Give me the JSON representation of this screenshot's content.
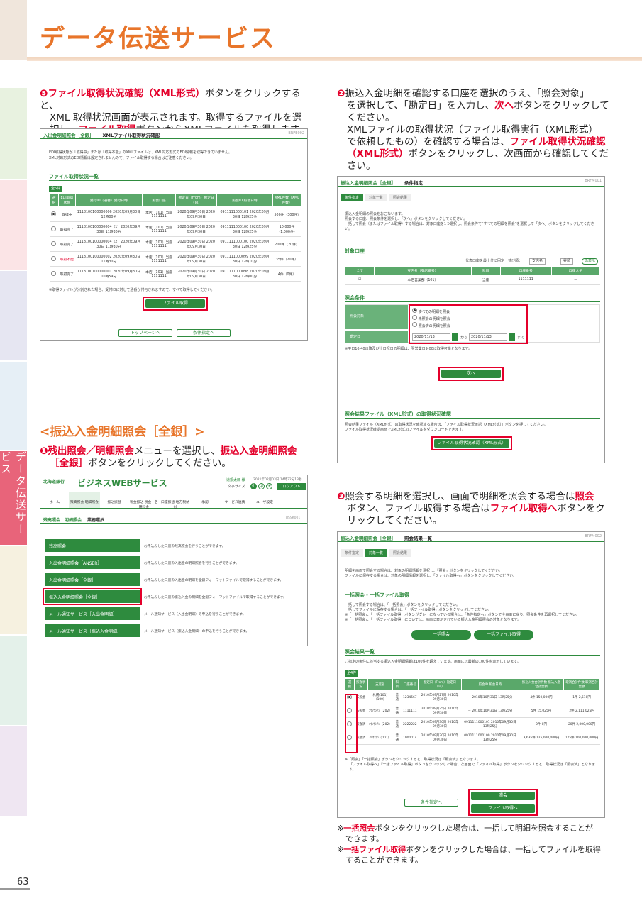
{
  "header": {
    "title": "データ伝送サービス"
  },
  "side_tab": "データ伝送サービス",
  "page_number": "63",
  "step5": {
    "num": "❺",
    "red1": "ファイル取得状況確認（XML形式）",
    "t1": "ボタンをクリックすると、",
    "l2": "XML 取得状況画面が表示されます。取得するファイルを選",
    "l3a": "択し、",
    "red2": "ファイル取得",
    "l3b": "ボタンからXMLファイルを取得します。"
  },
  "shot1": {
    "title": "入出金明細照会［全銀］",
    "subtitle": "XMLファイル取得状況確認",
    "id": "BRPE002",
    "note": "EDI取得状態が「取得中」または「取得不能」のXMLファイルは、XML対応形式のEDI情報を取得できていません。",
    "note2": "XML対応形式のEDI情報は設定されませんので、ファイル取得する場合はご注意ください。",
    "section": "ファイル取得状況一覧",
    "count": "全5件",
    "cols": [
      "選択",
      "EDI取得状態",
      "受付ID（通番）受付日時",
      "照会口座",
      "勘定日（From）勘定日（To）",
      "照会ID 照会日時",
      "XML件数（XML件数）"
    ],
    "rows": [
      [
        "取得中",
        "1118100100000006 2020年09月30日 12時00分",
        "本店（101）当座 1111111",
        "2020年09月30日 2020年09月30日",
        "0911111000101 2020年09月30日 12時25分",
        "500件（300件）"
      ],
      [
        "取得完了",
        "1118100100000004（1）2020年09月30日 11時30分",
        "本店（101）当座 1111111",
        "2020年09月30日 2020年09月30日",
        "0911111000100 2020年09月30日 12時25分",
        "10,000件（1,000件）"
      ],
      [
        "取得完了",
        "1118100100000004（2）2020年09月30日 11時30分",
        "本店（101）当座 1111111",
        "2020年09月30日 2020年09月30日",
        "0911111000100 2020年09月30日 12時25分",
        "200件（20件）"
      ],
      [
        "取得不能",
        "1118100100000002 2020年09月30日 11時30分",
        "本店（101）当座 1111111",
        "2020年09月30日 2020年09月30日",
        "0911111000099 2020年09月30日 12時10分",
        "35件（20件）"
      ],
      [
        "取得完了",
        "1118100100000001 2020年09月30日 10時59分",
        "本店（101）当座 1111111",
        "2020年09月30日 2020年09月30日",
        "0911111000098 2020年09月30日 12時00分",
        "4件（0件）"
      ]
    ],
    "footnote": "※取得ファイルが分割された場合、受付IDに対して通番が付与されますので、すべて取得してください。",
    "btn_get": "ファイル取得",
    "btn_top": "トップページへ",
    "btn_cond": "条件指定へ"
  },
  "section_title": "<振込入金明細照会［全銀］>",
  "step1": {
    "num": "❶",
    "red1": "残出照会／明細照会",
    "t1": "メニューを選択し、",
    "red2": "振込入金明細照会",
    "red3": "［全銀］",
    "t2": "ボタンをクリックしてください。"
  },
  "shot2": {
    "bank": "北海道銀行",
    "service": "ビジネスWEBサービス",
    "user": "道銀太郎 様",
    "date": "2021年02月03日 14時32分13秒",
    "fontsize": "文字サイズ",
    "small": "小",
    "mid": "中",
    "large": "大",
    "logout": "ログアウト",
    "nav": [
      "ホーム",
      "残高照会 明細照会",
      "振込振替",
      "税金振込 税金・各種料金",
      "口座振替 地方税納付",
      "承認",
      "サービス連携",
      "ユーザ設定"
    ],
    "breadcrumb": "残高照会　明細照会",
    "page": "業務選択",
    "id": "BSSK001",
    "menu": [
      {
        "label": "残高照会",
        "desc": "お申込みした口座の残高照会を行うことができます。"
      },
      {
        "label": "入出金明細照会［ANSER］",
        "desc": "お申込みした口座の入出金の明細照会を行うことができます。"
      },
      {
        "label": "入出金明細照会［全銀］",
        "desc": "お申込みした口座の入出金の明細を全銀フォーマットファイルで取得することができます。"
      },
      {
        "label": "振込入金明細照会［全銀］",
        "desc": "お申込みした口座の振込入金の明細を全銀フォーマットファイルで取得することができます。"
      },
      {
        "label": "メール通知サービス［入出金明細］",
        "desc": "メール通知サービス（入出金明細）の申込を行うことができます。"
      },
      {
        "label": "メール通知サービス［振込入金明細］",
        "desc": "メール通知サービス（振込入金明細）の申込を行うことができます。"
      }
    ]
  },
  "step2": {
    "num": "❷",
    "l1": "振込入金明細を確認する口座を選択のうえ、「照会対象」",
    "l2": "を選択して、「勘定日」を入力し、",
    "red1": "次へ",
    "l2b": "ボタンをクリックして",
    "l3": "ください。",
    "l4": "XMLファイルの取得状況（ファイル取得実行（XML形式）",
    "l5a": "で依頼したもの）を確認する場合は、",
    "red2": "ファイル取得状況確認",
    "red3": "（XML形式）",
    "l6b": "ボタンをクリックし、次画面から確認してくだ",
    "l7": "さい。"
  },
  "shot3": {
    "title": "振込入金明細照会［全銀］",
    "subtitle": "条件指定",
    "id": "BRFM001",
    "steps": [
      "条件指定",
      "対象一覧",
      "照会結果"
    ],
    "intro1": "振込入金明細の照会をおこないます。",
    "intro2": "照会する口座、照会条件を選択し、「次へ」ボタンをクリックしてください。",
    "intro3": "一括して照会（またはファイル取得）する場合は、対象口座を1つ選択し、照会条件で\"すべての明細を照会\"を選択して「次へ」ボタンをクリックしてください。",
    "acct_head": "対象口座",
    "acct_opts": "代表口座を最上位に固定　並び順：",
    "sel1": "支店名",
    "sel2": "昇順",
    "resort": "再表示",
    "cols": [
      "全て",
      "支店名（支店番号）",
      "科目",
      "口座番号",
      "口座メモ"
    ],
    "row": [
      "本店営業部（101）",
      "当座",
      "1111111",
      "－"
    ],
    "cond_head": "照会条件",
    "target_label": "照会対象",
    "opts": [
      "すべての明細を照会",
      "未照会の明細を照会",
      "照会済の明細を照会"
    ],
    "date_label": "勘定日",
    "date_from": "2020/11/13",
    "date_to": "2020/11/13",
    "kara": "から",
    "made": "まで",
    "note": "※平日16:40以降及び土日祝日の明細は、翌営業日9:00に取得可能となります。",
    "next": "次へ",
    "xml_head": "照会結果ファイル（XML形式）の取得状況確認",
    "xml_t1": "照会結果ファイル（XML形式）の取得状況を確認する場合は、「ファイル取得状況確認（XML形式）」ボタンを押してください。",
    "xml_t2": "ファイル取得状況確認画面でXML形式のファイルをダウンロードできます。",
    "xml_btn": "ファイル取得状況確認（XML形式）"
  },
  "step3": {
    "num": "❸",
    "l1a": "照会する明細を選択し、画面で明細を照会する場合は",
    "red1": "照会",
    "l2a": "ボタン、ファイル取得する場合は",
    "red2": "ファイル取得へ",
    "l2b": "ボタンをク",
    "l3": "リックしてください。"
  },
  "shot4": {
    "title": "振込入金明細照会［全銀］",
    "subtitle": "照会結果一覧",
    "id": "BRFM002",
    "steps": [
      "条件指定",
      "対象一覧",
      "照会結果"
    ],
    "intro1": "明細を画面で照会する場合は、対象の明細情報を選択し、「照会」ボタンをクリックしてください。",
    "intro2": "ファイルに保存する場合は、対象の明細情報を選択し、「ファイル取得へ」ボタンをクリックしてください。",
    "bulk_head": "一括照会・一括ファイル取得",
    "bulk_t1": "一括して照会する場合は、「一括照会」ボタンをクリックしてください。",
    "bulk_t2": "一括してファイルに保存する場合は、「一括ファイル取得」ボタンをクリックしてください。",
    "bulk_t3": "※「一括照会」、「一括ファイル取得」ボタンがグレーになっている場合は、「条件指定へ」ボタンで全画面に戻り、照会条件を再選択してください。",
    "bulk_t4": "※「一括照会」、「一括ファイル取得」については、画面に表示されている振込入金明細照会の対象となります。",
    "btn_bulk": "一括照会",
    "btn_bulkfile": "一括ファイル取得",
    "res_head": "照会結果一覧",
    "res_note": "ご指定の条件に該当する振込入金明細情報は100件を超えています。画面には最新の100件を表示しています。",
    "count": "全4件",
    "cols": [
      "選択",
      "照会状況",
      "支店名",
      "科目",
      "口座番号",
      "勘定日（From）勘定日（To）",
      "照会ID 照会日時",
      "振込入金合計件数 振込入金合計金額",
      "取消合計件数 取消合計金額"
    ],
    "rows": [
      [
        "未照会",
        "札幌(101)（100）",
        "普通",
        "1234567",
        "2010年09月27日 2010年09月30日",
        "－ 2010年10月31日 13時25分",
        "4件 150,000円",
        "1件 2,510円"
      ],
      [
        "未照会",
        "ｺｳｿｳｼﾃﾝ（202）",
        "普通",
        "1111111",
        "2010年09月25日 2010年09月30日",
        "－ 2010年10月31日 13時25分",
        "5件 15,025円",
        "2件 2,111,025円"
      ],
      [
        "照会済",
        "ｺｳｿｳｼﾃﾝ（202）",
        "普通",
        "2222222",
        "2010年09月30日 2010年09月30日",
        "0911111000101 2010年09月30日 13時25分",
        "0件 0円",
        "20件 2,000,000円"
      ],
      [
        "照会済",
        "ｸﾙﾏｼﾃﾝ（001）",
        "普通",
        "1000014",
        "2010年09月30日 2010年09月30日",
        "0911111000100 2010年09月30日 13時25分",
        "3,635件 125,000,000円",
        "125件 100,000,000円"
      ]
    ],
    "foot1": "※「照会」「一括照会」ボタンをクリックすると、取得状況は「照会済」となります。",
    "foot2": "「ファイル取得へ」「一括ファイル取得」ボタンをクリックした場合、次画面で「ファイル取得」ボタンをクリックすると、取得状況は「照会済」となります。",
    "btn_cond": "条件指定へ",
    "btn_inq": "照会",
    "btn_file": "ファイル取得へ"
  },
  "notes": {
    "n1pre": "※",
    "n1red": "一括照会",
    "n1t": "ボタンをクリックした場合は、一括して明細を照会することが",
    "n1t2": "できます。",
    "n2pre": "※",
    "n2red": "一括ファイル取得",
    "n2t": "ボタンをクリックした場合は、一括してファイルを取得",
    "n2t2": "することができます。"
  },
  "colors": {
    "accent": "#e8752a",
    "green": "#2e8b3e",
    "red": "#e4002b",
    "tab": "#e8647a"
  }
}
